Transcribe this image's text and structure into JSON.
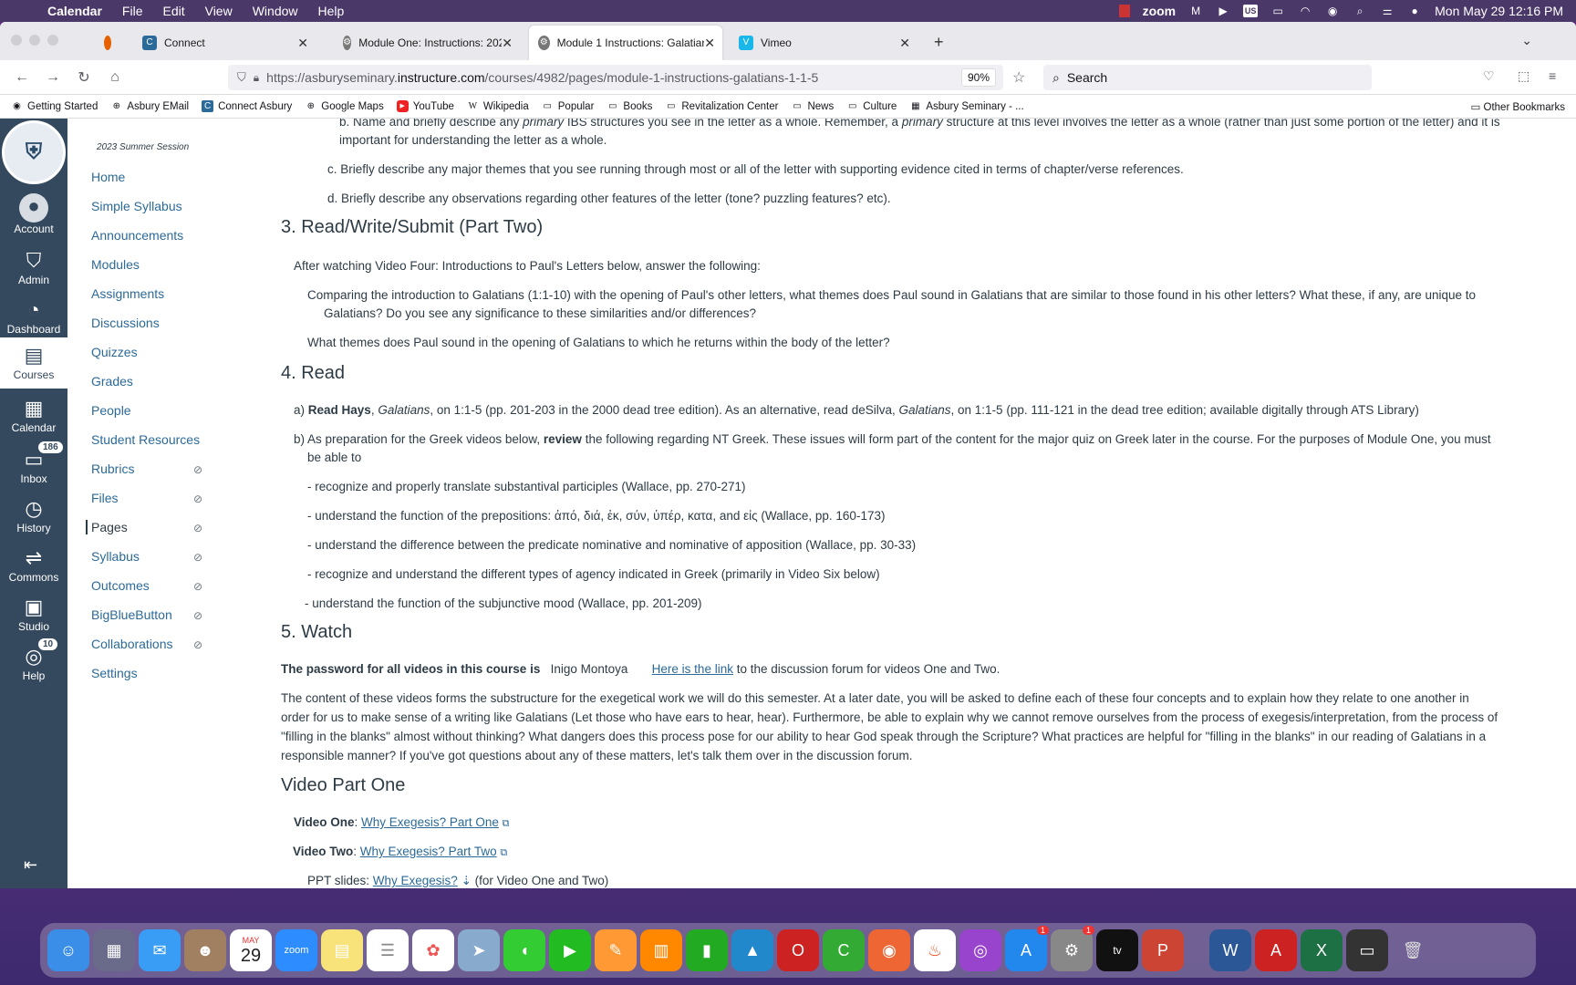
{
  "menubar": {
    "app": "Calendar",
    "items": [
      "File",
      "Edit",
      "View",
      "Window",
      "Help"
    ],
    "status_zoom": "zoom",
    "status_us": "US",
    "datetime": "Mon May 29  12:16 PM"
  },
  "tabs": [
    {
      "label": "Connect"
    },
    {
      "label": "Module One: Instructions: 2022"
    },
    {
      "label": "Module 1 Instructions: Galatians"
    },
    {
      "label": "Vimeo"
    }
  ],
  "url": {
    "prefix": "https://asburyseminary.",
    "host": "instructure.com",
    "path": "/courses/4982/pages/module-1-instructions-galatians-1-1-5",
    "zoom": "90%"
  },
  "search": {
    "placeholder": "Search"
  },
  "bookmarks": [
    "Getting Started",
    "Asbury EMail",
    "Connect Asbury",
    "Google Maps",
    "YouTube",
    "Wikipedia",
    "Popular",
    "Books",
    "Revitalization Center",
    "News",
    "Culture",
    "Asbury Seminary - ..."
  ],
  "other_bookmarks": "Other Bookmarks",
  "global_nav": [
    {
      "label": "Account",
      "icon": "account-icon"
    },
    {
      "label": "Admin",
      "icon": "admin-icon"
    },
    {
      "label": "Dashboard",
      "icon": "dashboard-icon"
    },
    {
      "label": "Courses",
      "icon": "courses-icon"
    },
    {
      "label": "Calendar",
      "icon": "calendar-icon"
    },
    {
      "label": "Inbox",
      "icon": "inbox-icon",
      "badge": "186"
    },
    {
      "label": "History",
      "icon": "history-icon"
    },
    {
      "label": "Commons",
      "icon": "commons-icon"
    },
    {
      "label": "Studio",
      "icon": "studio-icon"
    },
    {
      "label": "Help",
      "icon": "help-icon",
      "badge": "10"
    }
  ],
  "course_nav": {
    "session": "2023 Summer Session",
    "items": [
      "Home",
      "Simple Syllabus",
      "Announcements",
      "Modules",
      "Assignments",
      "Discussions",
      "Quizzes",
      "Grades",
      "People",
      "Student Resources",
      "Rubrics",
      "Files",
      "Pages",
      "Syllabus",
      "Outcomes",
      "BigBlueButton",
      "Collaborations",
      "Settings"
    ]
  },
  "content": {
    "b_line1_pre": "b. Name and briefly describe any ",
    "b_line1_em": "primary",
    "b_line1_mid": " IBS structures you see in the letter as a whole. Remember, a ",
    "b_line1_em2": "primary",
    "b_line1_post": " structure at this level involves the letter as a whole (rather than just some portion of the letter) and it is",
    "b_line2": "important for understanding the letter as a whole.",
    "c": "c. Briefly describe any major themes that you see running through most or all of the letter with supporting evidence cited in terms of chapter/verse references.",
    "d": "d. Briefly describe any observations regarding other features of the letter (tone? puzzling features? etc).",
    "h3": "3. Read/Write/Submit (Part Two)",
    "p3a": "After watching Video Four: Introductions to Paul's Letters below, answer the following:",
    "p3b1": "Comparing the introduction to Galatians (1:1-10) with the opening of Paul's other letters, what themes does Paul sound in Galatians  that are similar to those found in his other letters? What these, if any, are unique to",
    "p3b2": "Galatians? Do you see any significance to these similarities and/or differences?",
    "p3c": "What themes does Paul sound in the opening of Galatians to which he returns within the body of the letter?",
    "h4": "4. Read",
    "r_a_pre": "a) ",
    "r_a_bold": "Read Hays",
    "r_a_it1": "Galatians",
    "r_a_mid": ", on 1:1-5 (pp. 201-203 in the 2000 dead tree edition). As an alternative, read deSilva, ",
    "r_a_it2": "Galatians",
    "r_a_post": ", on 1:1-5 (pp. 111-121 in the dead tree edition; available digitally through ATS Library)",
    "r_b_pre": "b) As preparation for the Greek videos below, ",
    "r_b_bold": "review",
    "r_b_post": " the following regarding NT Greek. These issues will form part of the content for the major quiz on Greek later in the course. For the purposes of Module One, you must",
    "r_b2": "be able to",
    "li1": "- recognize and properly translate substantival participles (Wallace, pp. 270-271)",
    "li2": "- understand the function of the prepositions: ἀπό, διά, ἐκ, σύν, ὑπέρ, κατα, and εἰς (Wallace, pp. 160-173)",
    "li3": "- understand the difference between the predicate nominative and nominative of apposition (Wallace, pp. 30-33)",
    "li4": "- recognize and understand the different types of agency indicated in Greek (primarily in Video Six below)",
    "li5": "- understand the function of the subjunctive mood (Wallace, pp. 201-209)",
    "h5": "5. Watch",
    "pw_bold": "The password for all videos in this course is",
    "pw_value": "Inigo Montoya",
    "pw_link": "Here is the link",
    "pw_post": " to the discussion forum for videos One and Two.",
    "para1": "The content of these videos forms the substructure for the exegetical work we will do this semester. At a later date, you will be asked to define each of these four concepts and to explain how they relate to one another in",
    "para2": "order for us to make sense of a writing like Galatians  (Let those who have ears to hear, hear). Furthermore, be able to explain why we cannot remove ourselves from the process of exegesis/interpretation, from the process of",
    "para3": "\"filling in the blanks\" almost without thinking? What dangers does this process pose for our ability to hear God speak through the Scripture? What practices are helpful for \"filling in the blanks\" in our reading of Galatians in a",
    "para4": "responsible manner? If you've got questions about any of these matters, let's talk them over in the discussion forum.",
    "hv": "Video Part One",
    "v1_label": "Video One",
    "v1_link": "Why Exegesis? Part One",
    "v2_label": "Video Two",
    "v2_link": "Why Exegesis? Part Two",
    "ppt_label": "PPT slides: ",
    "ppt_link": "Why Exegesis?",
    "ppt_post": " (for Video One and Two)"
  },
  "dock": {
    "calendar_month": "MAY",
    "calendar_day": "29",
    "zoom": "zoom",
    "badge_appstore": "1",
    "badge_settings": "1"
  }
}
